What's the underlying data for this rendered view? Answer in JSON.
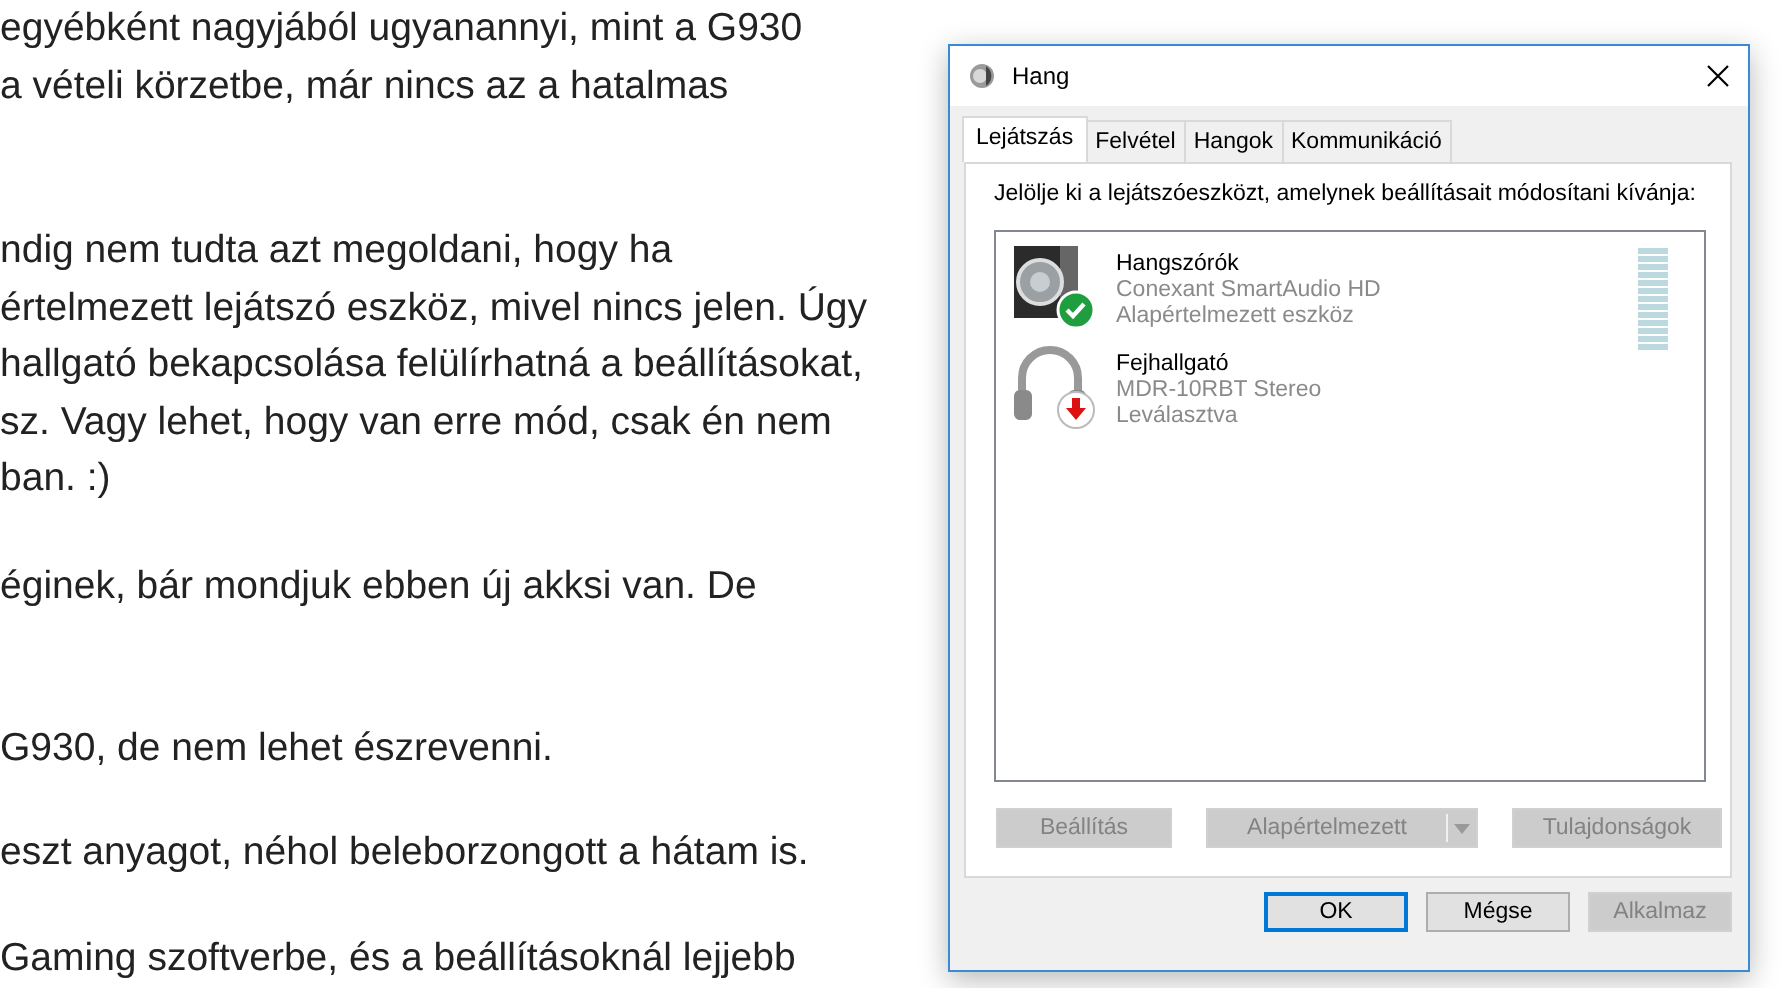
{
  "article": {
    "paragraphs": [
      {
        "lines": [
          "egyébként nagyjából ugyanannyi, mint a G930",
          "a vételi körzetbe, már nincs az a hatalmas"
        ]
      },
      {
        "lines": [
          "ndig nem tudta azt megoldani, hogy ha",
          "értelmezett lejátszó eszköz, mivel nincs jelen. Úgy",
          "hallgató bekapcsolása felülírhatná a beállításokat,",
          "sz. Vagy lehet, hogy van erre mód, csak én nem",
          "ban. :)"
        ]
      },
      {
        "lines": [
          "éginek, bár mondjuk ebben új akksi van. De"
        ]
      },
      {
        "lines": [
          "G930, de nem lehet észrevenni."
        ]
      },
      {
        "lines": [
          "eszt anyagot, néhol beleborzongott a hátam is."
        ]
      },
      {
        "lines": [
          "Gaming szoftverbe, és a beállításoknál lejjebb"
        ]
      }
    ]
  },
  "window": {
    "title": "Hang"
  },
  "tabs": [
    {
      "label": "Lejátszás",
      "selected": true
    },
    {
      "label": "Felvétel",
      "selected": false
    },
    {
      "label": "Hangok",
      "selected": false
    },
    {
      "label": "Kommunikáció",
      "selected": false
    }
  ],
  "instruction": "Jelölje ki a lejátszóeszközt, amelynek beállításait módosítani kívánja:",
  "devices": [
    {
      "kind": "speaker",
      "name": "Hangszórók",
      "driver": "Conexant SmartAudio HD",
      "status": "Alapértelmezett eszköz"
    },
    {
      "kind": "headphones",
      "name": "Fejhallgató",
      "driver": "MDR-10RBT Stereo",
      "status": "Leválasztva"
    }
  ],
  "device_buttons": [
    {
      "label": "Beállítás",
      "disabled": true,
      "kind": "plain"
    },
    {
      "label": "Alapértelmezett",
      "disabled": true,
      "kind": "split"
    },
    {
      "label": "Tulajdonságok",
      "disabled": true,
      "kind": "plain"
    }
  ],
  "dialog_buttons": [
    {
      "label": "OK",
      "disabled": false,
      "focused": true
    },
    {
      "label": "Mégse",
      "disabled": false,
      "focused": false
    },
    {
      "label": "Alkalmaz",
      "disabled": true,
      "focused": false
    }
  ]
}
